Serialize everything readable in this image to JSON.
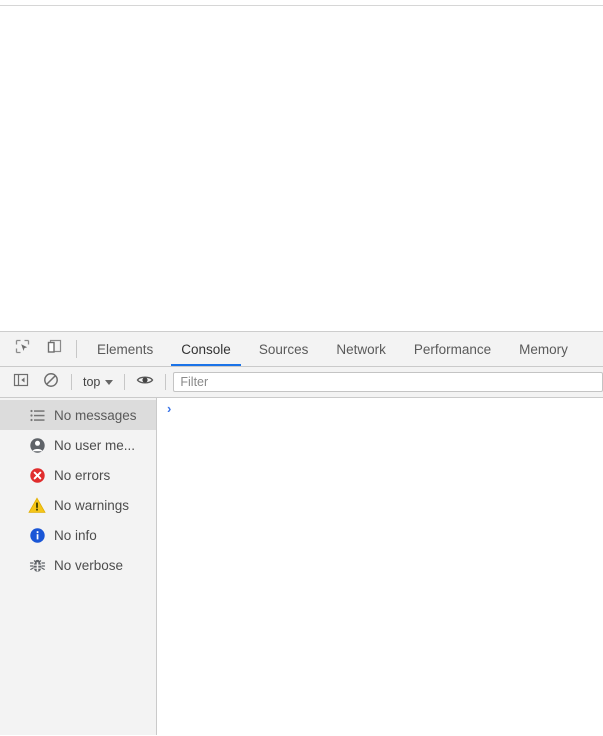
{
  "window": {
    "page_background": "#ffffff",
    "devtools_background": "#f3f3f3",
    "accent_color": "#1a73e8"
  },
  "tabbar": {
    "inspect_icon": "inspect-cursor-icon",
    "device_toolbar_icon": "device-toolbar-icon",
    "tabs": [
      {
        "label": "Elements",
        "active": false
      },
      {
        "label": "Console",
        "active": true
      },
      {
        "label": "Sources",
        "active": false
      },
      {
        "label": "Network",
        "active": false
      },
      {
        "label": "Performance",
        "active": false
      },
      {
        "label": "Memory",
        "active": false
      }
    ]
  },
  "filterbar": {
    "sidebar_toggle_icon": "show-console-sidebar-icon",
    "clear_console_icon": "clear-console-icon",
    "context_selector": {
      "value": "top",
      "caret_icon": "chevron-down-icon"
    },
    "live_expression_icon": "eye-icon",
    "filter": {
      "value": "",
      "placeholder": "Filter"
    }
  },
  "sidebar": {
    "items": [
      {
        "label": "No messages",
        "icon": "list-icon",
        "icon_color": "#757575",
        "selected": true
      },
      {
        "label": "No user me...",
        "icon": "user-icon",
        "icon_color": "#5f6368",
        "selected": false
      },
      {
        "label": "No errors",
        "icon": "error-icon",
        "icon_color": "#e02d2d",
        "selected": false
      },
      {
        "label": "No warnings",
        "icon": "warning-icon",
        "icon_color": "#f5c518",
        "selected": false
      },
      {
        "label": "No info",
        "icon": "info-icon",
        "icon_color": "#1a56d6",
        "selected": false
      },
      {
        "label": "No verbose",
        "icon": "bug-icon",
        "icon_color": "#5f6368",
        "selected": false
      }
    ]
  },
  "console": {
    "prompt_chevron": "›",
    "prompt_value": "",
    "messages": []
  }
}
